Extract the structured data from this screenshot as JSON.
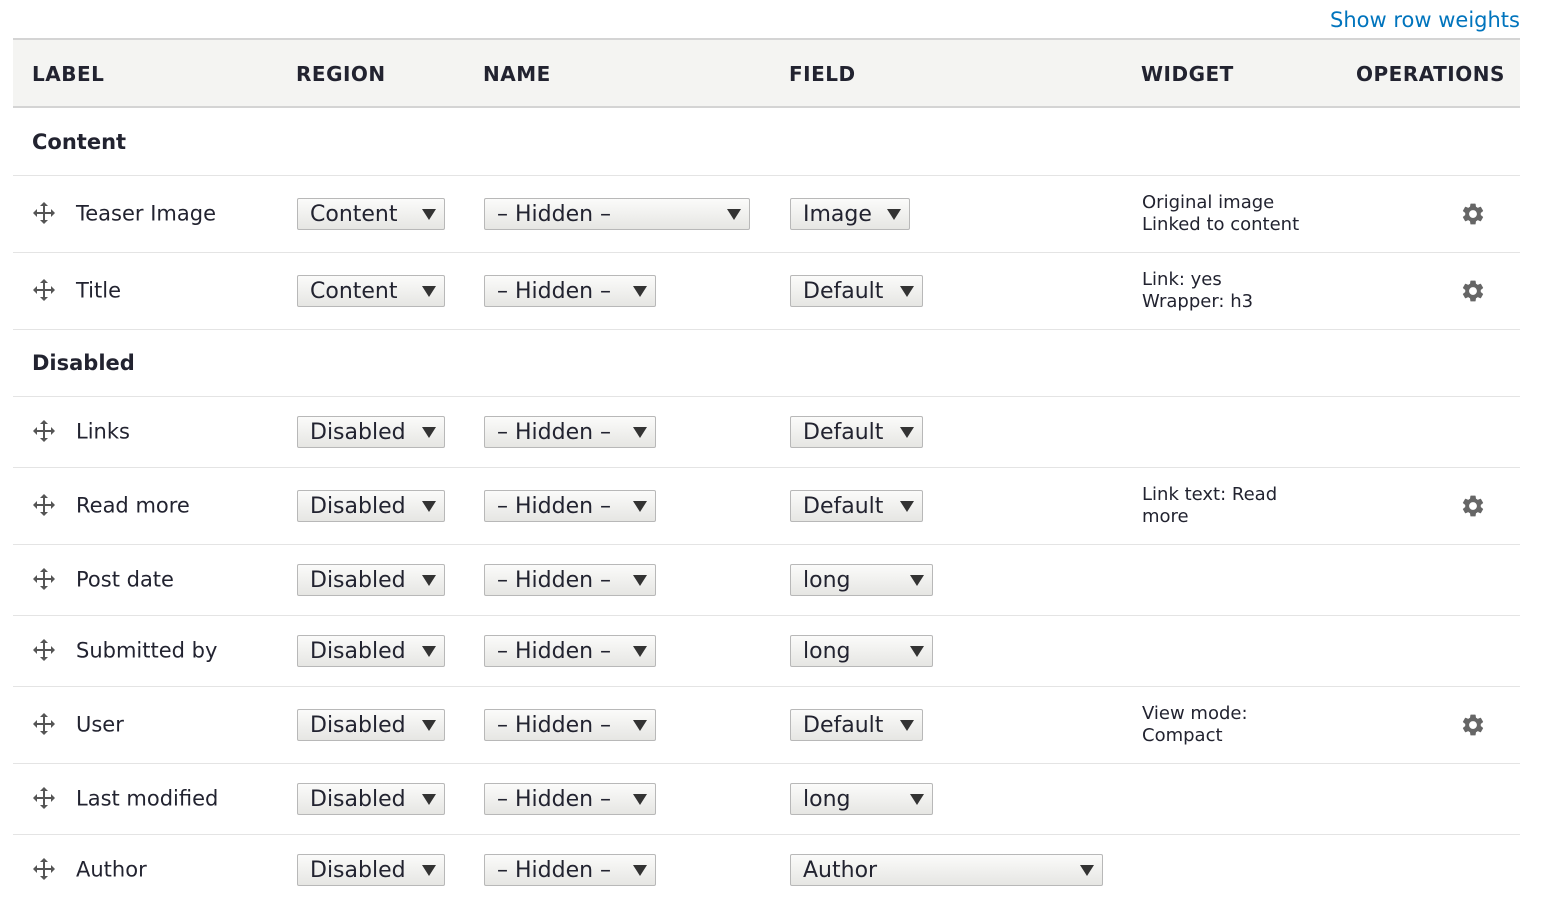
{
  "show_row_weights": "Show row weights",
  "columns": {
    "label": "LABEL",
    "region": "REGION",
    "name": "NAME",
    "field": "FIELD",
    "widget": "WIDGET",
    "operations": "OPERATIONS"
  },
  "regions": [
    {
      "title": "Content",
      "rows": [
        {
          "label": "Teaser Image",
          "region": "Content",
          "name": "– Hidden –",
          "field": "Image",
          "summary": [
            "Original image",
            "Linked to content"
          ],
          "has_settings": true
        },
        {
          "label": "Title",
          "region": "Content",
          "name": "– Hidden –",
          "field": "Default",
          "summary": [
            "Link: yes",
            "Wrapper: h3"
          ],
          "has_settings": true
        }
      ]
    },
    {
      "title": "Disabled",
      "rows": [
        {
          "label": "Links",
          "region": "Disabled",
          "name": "– Hidden –",
          "field": "Default",
          "summary": [],
          "has_settings": false
        },
        {
          "label": "Read more",
          "region": "Disabled",
          "name": "– Hidden –",
          "field": "Default",
          "summary": [
            "Link text: Read",
            "more"
          ],
          "has_settings": true
        },
        {
          "label": "Post date",
          "region": "Disabled",
          "name": "– Hidden –",
          "field": "long",
          "summary": [],
          "has_settings": false
        },
        {
          "label": "Submitted by",
          "region": "Disabled",
          "name": "– Hidden –",
          "field": "long",
          "summary": [],
          "has_settings": false
        },
        {
          "label": "User",
          "region": "Disabled",
          "name": "– Hidden –",
          "field": "Default",
          "summary": [
            "View mode:",
            "Compact"
          ],
          "has_settings": true
        },
        {
          "label": "Last modified",
          "region": "Disabled",
          "name": "– Hidden –",
          "field": "long",
          "summary": [],
          "has_settings": false
        },
        {
          "label": "Author",
          "region": "Disabled",
          "name": "– Hidden –",
          "field": "Author",
          "summary": [],
          "has_settings": false
        }
      ]
    }
  ]
}
